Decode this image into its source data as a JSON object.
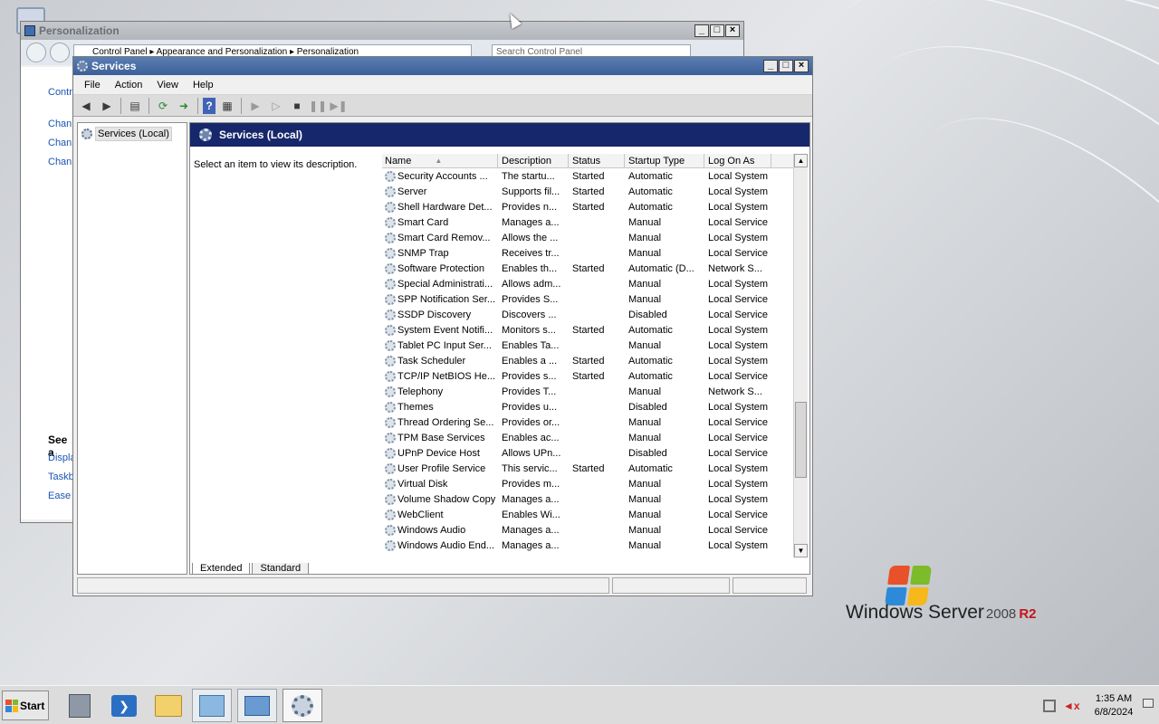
{
  "personalization_window": {
    "title": "Personalization",
    "breadcrumb": "Control Panel ▸ Appearance and Personalization ▸ Personalization",
    "search_placeholder": "Search Control Panel",
    "sidebar_links_top": [
      "Contr",
      "Chan",
      "Chan",
      "Chan"
    ],
    "see_also_title": "See a",
    "sidebar_links_bottom": [
      "Displa",
      "Taskb",
      "Ease"
    ]
  },
  "services_window": {
    "title": "Services",
    "menu": [
      "File",
      "Action",
      "View",
      "Help"
    ],
    "tree_node": "Services (Local)",
    "panel_title": "Services (Local)",
    "description_prompt": "Select an item to view its description.",
    "columns": [
      "Name",
      "Description",
      "Status",
      "Startup Type",
      "Log On As"
    ],
    "rows": [
      [
        "Security Accounts ...",
        "The startu...",
        "Started",
        "Automatic",
        "Local System"
      ],
      [
        "Server",
        "Supports fil...",
        "Started",
        "Automatic",
        "Local System"
      ],
      [
        "Shell Hardware Det...",
        "Provides n...",
        "Started",
        "Automatic",
        "Local System"
      ],
      [
        "Smart Card",
        "Manages a...",
        "",
        "Manual",
        "Local Service"
      ],
      [
        "Smart Card Remov...",
        "Allows the ...",
        "",
        "Manual",
        "Local System"
      ],
      [
        "SNMP Trap",
        "Receives tr...",
        "",
        "Manual",
        "Local Service"
      ],
      [
        "Software Protection",
        "Enables th...",
        "Started",
        "Automatic (D...",
        "Network S..."
      ],
      [
        "Special Administrati...",
        "Allows adm...",
        "",
        "Manual",
        "Local System"
      ],
      [
        "SPP Notification Ser...",
        "Provides S...",
        "",
        "Manual",
        "Local Service"
      ],
      [
        "SSDP Discovery",
        "Discovers ...",
        "",
        "Disabled",
        "Local Service"
      ],
      [
        "System Event Notifi...",
        "Monitors s...",
        "Started",
        "Automatic",
        "Local System"
      ],
      [
        "Tablet PC Input Ser...",
        "Enables Ta...",
        "",
        "Manual",
        "Local System"
      ],
      [
        "Task Scheduler",
        "Enables a ...",
        "Started",
        "Automatic",
        "Local System"
      ],
      [
        "TCP/IP NetBIOS He...",
        "Provides s...",
        "Started",
        "Automatic",
        "Local Service"
      ],
      [
        "Telephony",
        "Provides T...",
        "",
        "Manual",
        "Network S..."
      ],
      [
        "Themes",
        "Provides u...",
        "",
        "Disabled",
        "Local System"
      ],
      [
        "Thread Ordering Se...",
        "Provides or...",
        "",
        "Manual",
        "Local Service"
      ],
      [
        "TPM Base Services",
        "Enables ac...",
        "",
        "Manual",
        "Local Service"
      ],
      [
        "UPnP Device Host",
        "Allows UPn...",
        "",
        "Disabled",
        "Local Service"
      ],
      [
        "User Profile Service",
        "This servic...",
        "Started",
        "Automatic",
        "Local System"
      ],
      [
        "Virtual Disk",
        "Provides m...",
        "",
        "Manual",
        "Local System"
      ],
      [
        "Volume Shadow Copy",
        "Manages a...",
        "",
        "Manual",
        "Local System"
      ],
      [
        "WebClient",
        "Enables Wi...",
        "",
        "Manual",
        "Local Service"
      ],
      [
        "Windows Audio",
        "Manages a...",
        "",
        "Manual",
        "Local Service"
      ],
      [
        "Windows Audio End...",
        "Manages a...",
        "",
        "Manual",
        "Local System"
      ]
    ],
    "tabs": [
      "Extended",
      "Standard"
    ]
  },
  "desktop": {
    "brand_main": "Windows Server",
    "brand_version": "2008",
    "brand_suffix": "R2"
  },
  "taskbar": {
    "start_label": "Start",
    "time": "1:35 AM",
    "date": "6/8/2024"
  },
  "colors": {
    "titlebar_active": "#3b5f97",
    "panel_header": "#17276b",
    "logo_red": "#e8512a",
    "logo_green": "#7cbb2a",
    "logo_blue": "#2d8ad8",
    "logo_yellow": "#f6b81a"
  }
}
